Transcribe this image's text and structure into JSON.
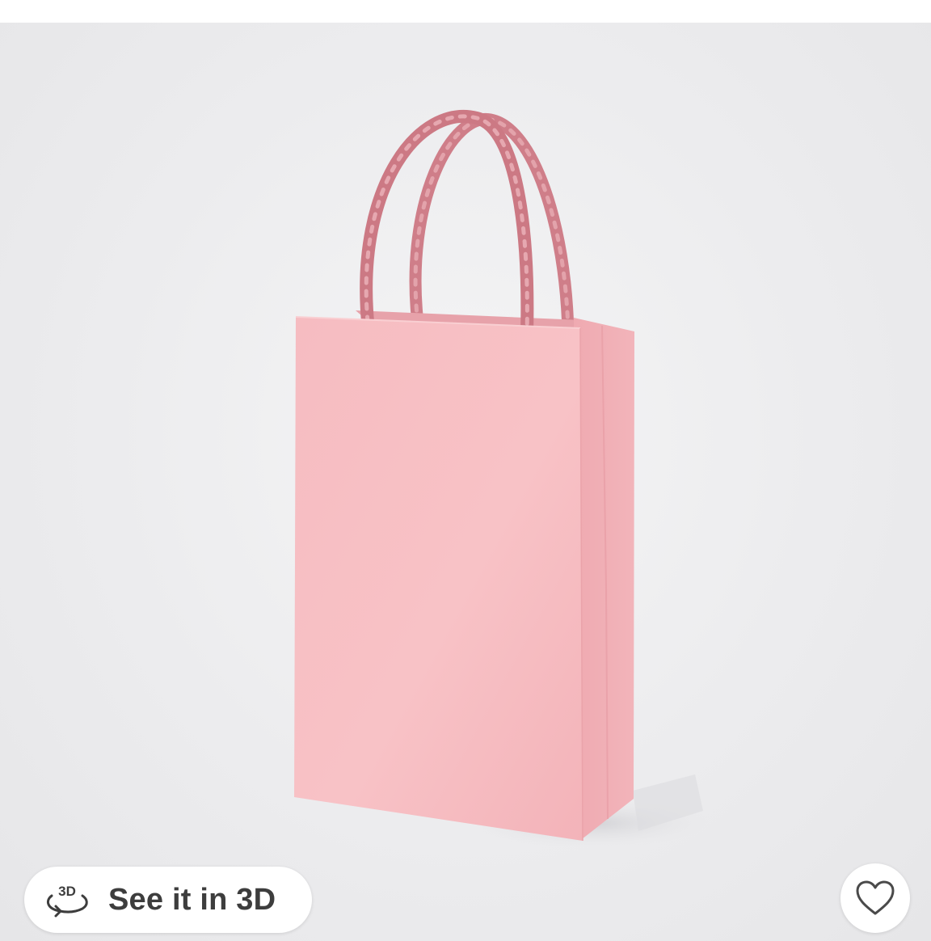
{
  "product": {
    "image_name": "pink-gift-bag-image",
    "colors": {
      "background": "#ececee",
      "bag": "#f5bcc0",
      "handle": "#d98a94"
    }
  },
  "view_3d_button": {
    "label": "See it in 3D",
    "icon": "3d-rotate-icon",
    "icon_text": "3D"
  },
  "favorite_button": {
    "icon": "heart-outline-icon",
    "selected": false
  }
}
